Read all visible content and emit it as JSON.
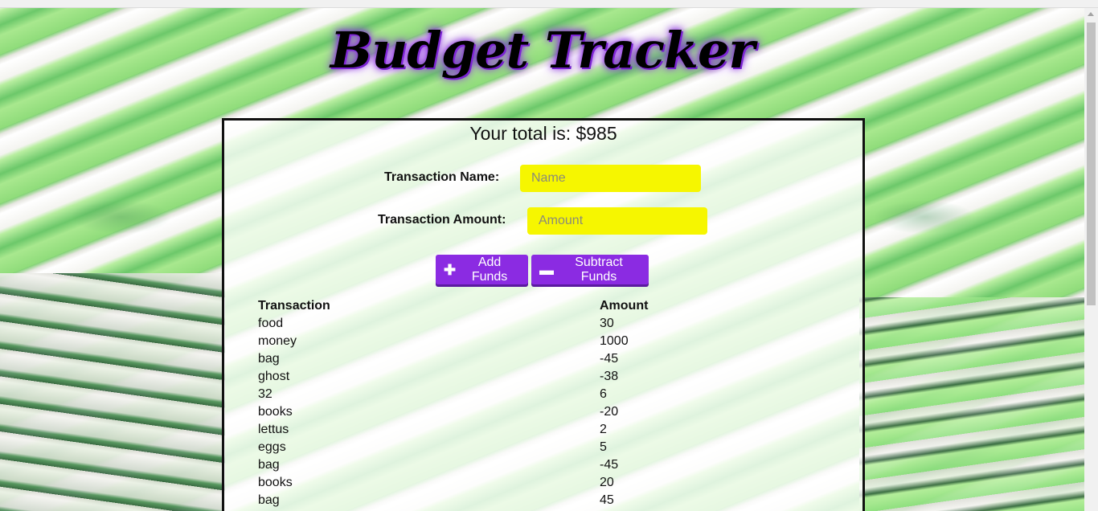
{
  "header": {
    "title": "Budget Tracker"
  },
  "summary": {
    "total_text": "Your total is: $985"
  },
  "form": {
    "name_label": "Transaction Name:",
    "name_placeholder": "Name",
    "amount_label": "Transaction Amount:",
    "amount_placeholder": "Amount"
  },
  "buttons": {
    "add_label": "Add Funds",
    "add_icon": "plus-icon",
    "subtract_label": "Subtract Funds",
    "subtract_icon": "minus-icon"
  },
  "table": {
    "headers": [
      "Transaction",
      "Amount"
    ],
    "rows": [
      [
        "food",
        "30"
      ],
      [
        "money",
        "1000"
      ],
      [
        "bag",
        "-45"
      ],
      [
        "ghost",
        "-38"
      ],
      [
        "32",
        "6"
      ],
      [
        "books",
        "-20"
      ],
      [
        "lettus",
        "2"
      ],
      [
        "eggs",
        "5"
      ],
      [
        "bag",
        "-45"
      ],
      [
        "books",
        "20"
      ],
      [
        "bag",
        "45"
      ]
    ]
  },
  "colors": {
    "accent": "#8b2be2",
    "input_bg": "#f6f600"
  }
}
